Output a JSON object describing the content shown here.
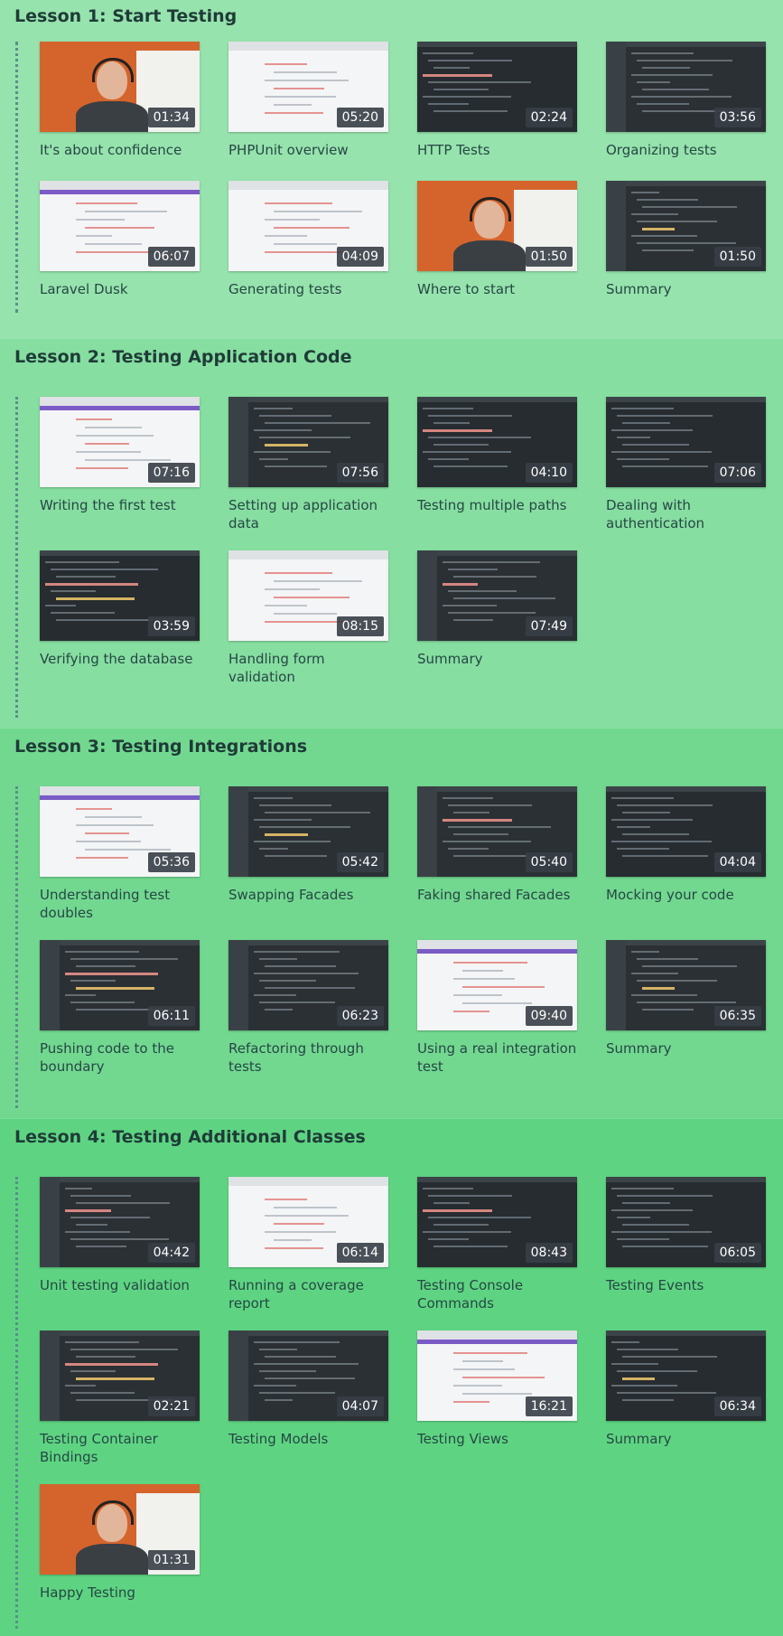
{
  "lessons": [
    {
      "title": "Lesson 1: Start Testing",
      "videos": [
        {
          "title": "It's about confidence",
          "duration": "01:34",
          "thumb": "camera"
        },
        {
          "title": "PHPUnit overview",
          "duration": "05:20",
          "thumb": "browser"
        },
        {
          "title": "HTTP Tests",
          "duration": "02:24",
          "thumb": "dark"
        },
        {
          "title": "Organizing tests",
          "duration": "03:56",
          "thumb": "editor"
        },
        {
          "title": "Laravel Dusk",
          "duration": "06:07",
          "thumb": "browser"
        },
        {
          "title": "Generating tests",
          "duration": "04:09",
          "thumb": "browser"
        },
        {
          "title": "Where to start",
          "duration": "01:50",
          "thumb": "camera"
        },
        {
          "title": "Summary",
          "duration": "01:50",
          "thumb": "editor"
        }
      ]
    },
    {
      "title": "Lesson 2: Testing Application Code",
      "videos": [
        {
          "title": "Writing the first test",
          "duration": "07:16",
          "thumb": "browser"
        },
        {
          "title": "Setting up application data",
          "duration": "07:56",
          "thumb": "editor"
        },
        {
          "title": "Testing multiple paths",
          "duration": "04:10",
          "thumb": "dark"
        },
        {
          "title": "Dealing with authentication",
          "duration": "07:06",
          "thumb": "dark"
        },
        {
          "title": "Verifying the database",
          "duration": "03:59",
          "thumb": "dark"
        },
        {
          "title": "Handling form validation",
          "duration": "08:15",
          "thumb": "browser"
        },
        {
          "title": "Summary",
          "duration": "07:49",
          "thumb": "editor"
        }
      ]
    },
    {
      "title": "Lesson 3: Testing Integrations",
      "videos": [
        {
          "title": "Understanding test doubles",
          "duration": "05:36",
          "thumb": "browser"
        },
        {
          "title": "Swapping Facades",
          "duration": "05:42",
          "thumb": "editor"
        },
        {
          "title": "Faking shared Facades",
          "duration": "05:40",
          "thumb": "editor"
        },
        {
          "title": "Mocking your code",
          "duration": "04:04",
          "thumb": "dark"
        },
        {
          "title": "Pushing code to the boundary",
          "duration": "06:11",
          "thumb": "editor"
        },
        {
          "title": "Refactoring through tests",
          "duration": "06:23",
          "thumb": "editor"
        },
        {
          "title": "Using a real integration test",
          "duration": "09:40",
          "thumb": "browser"
        },
        {
          "title": "Summary",
          "duration": "06:35",
          "thumb": "editor"
        }
      ]
    },
    {
      "title": "Lesson 4: Testing Additional Classes",
      "videos": [
        {
          "title": "Unit testing validation",
          "duration": "04:42",
          "thumb": "editor"
        },
        {
          "title": "Running a coverage report",
          "duration": "06:14",
          "thumb": "browser"
        },
        {
          "title": "Testing Console Commands",
          "duration": "08:43",
          "thumb": "dark"
        },
        {
          "title": "Testing Events",
          "duration": "06:05",
          "thumb": "dark"
        },
        {
          "title": "Testing Container Bindings",
          "duration": "02:21",
          "thumb": "editor"
        },
        {
          "title": "Testing Models",
          "duration": "04:07",
          "thumb": "editor"
        },
        {
          "title": "Testing Views",
          "duration": "16:21",
          "thumb": "browser"
        },
        {
          "title": "Summary",
          "duration": "06:34",
          "thumb": "dark"
        },
        {
          "title": "Happy Testing",
          "duration": "01:31",
          "thumb": "camera"
        }
      ]
    }
  ]
}
